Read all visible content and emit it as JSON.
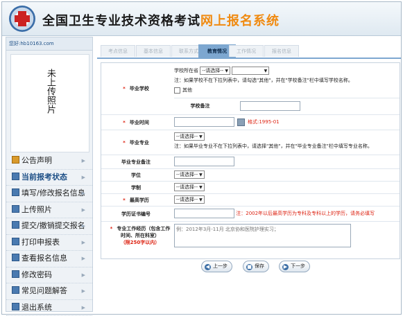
{
  "header": {
    "title_main": "全国卫生专业技术资格考试",
    "title_accent": "网上报名系统"
  },
  "sidebar": {
    "username": "您好:hb10163.com",
    "photo_text": "未上传照片",
    "items": [
      {
        "label": "公告声明",
        "icon": "house-icon"
      },
      {
        "label": "当前报考状态",
        "icon": "status-icon"
      },
      {
        "label": "填写/修改报名信息",
        "icon": "edit-icon"
      },
      {
        "label": "上传照片",
        "icon": "photo-icon"
      },
      {
        "label": "提交/撤销提交报名",
        "icon": "submit-icon"
      },
      {
        "label": "打印申报表",
        "icon": "print-icon"
      },
      {
        "label": "查看报名信息",
        "icon": "view-icon"
      },
      {
        "label": "修改密码",
        "icon": "key-icon"
      },
      {
        "label": "常见问题解答",
        "icon": "help-icon"
      },
      {
        "label": "退出系统",
        "icon": "exit-icon"
      }
    ]
  },
  "tabs": [
    "考点信息",
    "基本信息",
    "联系方式",
    "教育情况",
    "工作情况",
    "报名信息"
  ],
  "form": {
    "school": {
      "label": "毕业学校",
      "province_prefix": "学校所在省",
      "province_select": "--请选择--",
      "school_select": "",
      "note": "注：如果学校不在下拉列表中，请勾选\"其他\"，并在\"学校备注\"栏中填写学校名称。",
      "other_label": "其他",
      "remark_label": "学校备注"
    },
    "grad_time": {
      "label": "毕业时间",
      "format_hint": "格式:1995-01"
    },
    "major": {
      "label": "毕业专业",
      "select": "--请选择--",
      "note": "注：如果毕业专业不在下拉列表中，请选择\"其他\"，并在\"毕业专业备注\"栏中填写专业名称。"
    },
    "major_remark": {
      "label": "毕业专业备注"
    },
    "degree": {
      "label": "学位",
      "select": "--请选择--"
    },
    "academic_system": {
      "label": "学制",
      "select": "--请选择--"
    },
    "highest_edu": {
      "label": "最高学历",
      "select": "--请选择--"
    },
    "cert_no": {
      "label": "学历证书编号",
      "note": "注：2002年以后最高学历为专科及专科以上的学历，请务必填写"
    },
    "work_exp": {
      "label": "专业工作经历（包含工作时间、所在科室）",
      "limit": "（限250字以内）",
      "placeholder": "例：2012年3月-11月 北京协和医院护理实习；"
    }
  },
  "buttons": {
    "prev": "上一步",
    "save": "保存",
    "next": "下一步"
  }
}
